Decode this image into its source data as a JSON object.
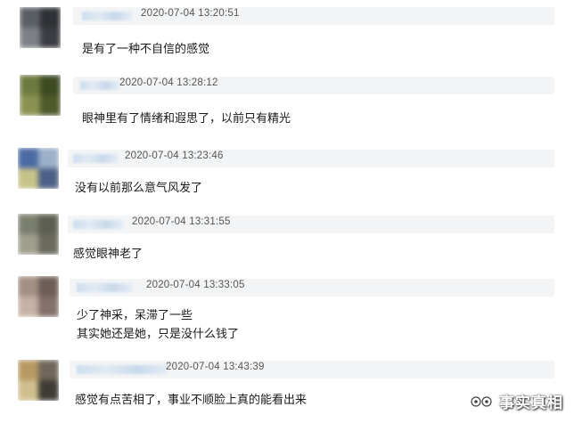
{
  "comments": [
    {
      "timestamp": "2020-07-04 13:20:51",
      "lines": [
        "是有了一种不自信的感觉"
      ],
      "avatar_colors": [
        "#5a5f66",
        "#2f3136",
        "#7d8087",
        "#3b3d42"
      ]
    },
    {
      "timestamp": "2020-07-04 13:28:12",
      "lines": [
        "眼神里有了情绪和遐思了，以前只有精光"
      ],
      "avatar_colors": [
        "#6d7a3f",
        "#3e4a22",
        "#8a9252",
        "#4f5a2b"
      ]
    },
    {
      "timestamp": "2020-07-04 13:23:46",
      "lines": [
        "没有以前那么意气风发了"
      ],
      "avatar_colors": [
        "#4a6aa3",
        "#9bb0c9",
        "#c7c28a",
        "#4c5f86"
      ]
    },
    {
      "timestamp": "2020-07-04 13:31:55",
      "lines": [
        "感觉眼神老了"
      ],
      "avatar_colors": [
        "#7b7f6e",
        "#5d5f52",
        "#a09f8e",
        "#6b6a5c"
      ]
    },
    {
      "timestamp": "2020-07-04 13:33:05",
      "lines": [
        "少了神采，呆滞了一些",
        "其实她还是她，只是没什么钱了"
      ],
      "avatar_colors": [
        "#a58f82",
        "#6e5d57",
        "#c7b2a5",
        "#85706a"
      ]
    },
    {
      "timestamp": "2020-07-04 13:43:39",
      "lines": [
        "感觉有点苦相了，事业不顺脸上真的能看出来"
      ],
      "avatar_colors": [
        "#b79a62",
        "#70675a",
        "#d0be8e",
        "#3e3b35"
      ]
    }
  ],
  "watermark": {
    "text": "事实真相"
  }
}
